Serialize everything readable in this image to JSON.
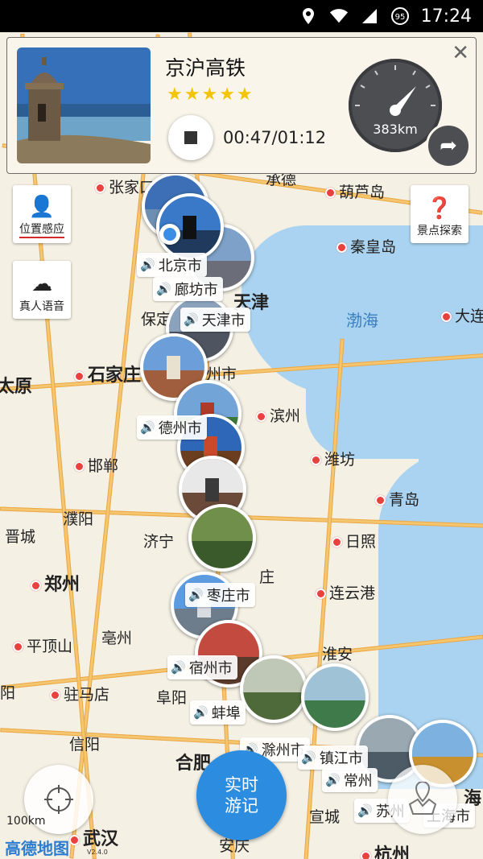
{
  "status_bar": {
    "time": "17:24",
    "battery": "95"
  },
  "card": {
    "title": "京沪高铁",
    "rating": 5,
    "stars": [
      "★",
      "★",
      "★",
      "★",
      "★"
    ],
    "time": "00:47/01:12",
    "distance": "383km",
    "close": "✕"
  },
  "side_buttons": {
    "location": "位置感应",
    "voice": "真人语音",
    "explore": "景点探索"
  },
  "realtime": {
    "line1": "实时",
    "line2": "游记"
  },
  "map_labels": {
    "zhangjiakou": "张家口",
    "chengde": "承德",
    "huludao": "葫芦岛",
    "qinhuangdao": "秦皇岛",
    "tianjin": "天津",
    "baoding": "保定",
    "bohai": "渤海",
    "dalian": "大连",
    "shijiazhuang": "石家庄",
    "taiyuan": "太原",
    "cangzhou": "州市",
    "binzhou": "滨州",
    "weifang": "潍坊",
    "handan": "邯郸",
    "qingdao": "青岛",
    "puyang": "濮阳",
    "jinning": "济宁",
    "rizhao": "日照",
    "jincheng": "晋城",
    "zhengzhou": "郑州",
    "zaozhuang": "庄",
    "lianyungang": "连云港",
    "bozhou": "亳州",
    "pingdingshan": "平顶山",
    "huaian": "淮安",
    "zhumadian": "驻马店",
    "nanyang": "阳",
    "fuyang": "阜阳",
    "xinyang": "信阳",
    "hefei": "合肥",
    "xuancheng": "宣城",
    "wuhan": "武汉",
    "anqing": "安庆",
    "hangzhou": "杭州",
    "shanghai": "海"
  },
  "stops": [
    {
      "name": "北京市"
    },
    {
      "name": "廊坊市"
    },
    {
      "name": "天津市"
    },
    {
      "name": "德州市"
    },
    {
      "name": "枣庄市"
    },
    {
      "name": "宿州市"
    },
    {
      "name": "蚌埠"
    },
    {
      "name": "滁州市"
    },
    {
      "name": "镇江市"
    },
    {
      "name": "常州"
    },
    {
      "name": "苏州"
    },
    {
      "name": "上海市"
    }
  ],
  "footer": {
    "scale": "100km",
    "logo": "高德地图",
    "version": "V2.4.0"
  },
  "colors": {
    "accent": "#2c8ce0",
    "star": "#f2c500",
    "sea": "#a9d3f0",
    "road": "#f6c66f"
  }
}
